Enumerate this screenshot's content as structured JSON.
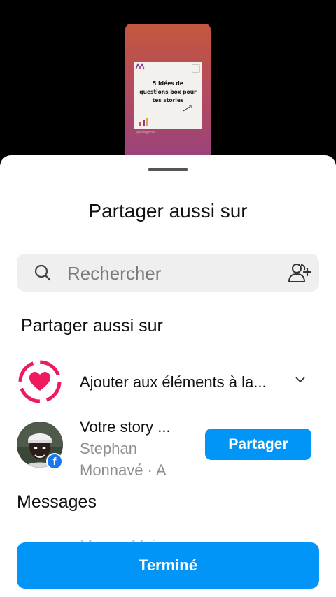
{
  "preview": {
    "post_title": "5 Idées de questions box pour tes stories",
    "post_handle": "@manageimoi"
  },
  "sheet": {
    "title": "Partager aussi sur"
  },
  "search": {
    "placeholder": "Rechercher"
  },
  "section": {
    "title": "Partager aussi sur"
  },
  "favorites": {
    "label": "Ajouter aux éléments à la..."
  },
  "story": {
    "title": "Votre story ...",
    "subtitle_line1": "Stephan",
    "subtitle_line2": "Monnayé · A",
    "share_label": "Partager"
  },
  "messages": {
    "title": "Messages",
    "partial_text": "Manon Moin"
  },
  "footer": {
    "done_label": "Terminé"
  },
  "colors": {
    "accent": "#0095f6",
    "heart": "#ee1b5f",
    "facebook": "#1877f2"
  },
  "icons": {
    "search": "search-icon",
    "add_people": "add-people-icon",
    "favorites": "favorites-heart-icon",
    "chevron": "chevron-down-icon",
    "facebook": "facebook-icon"
  }
}
